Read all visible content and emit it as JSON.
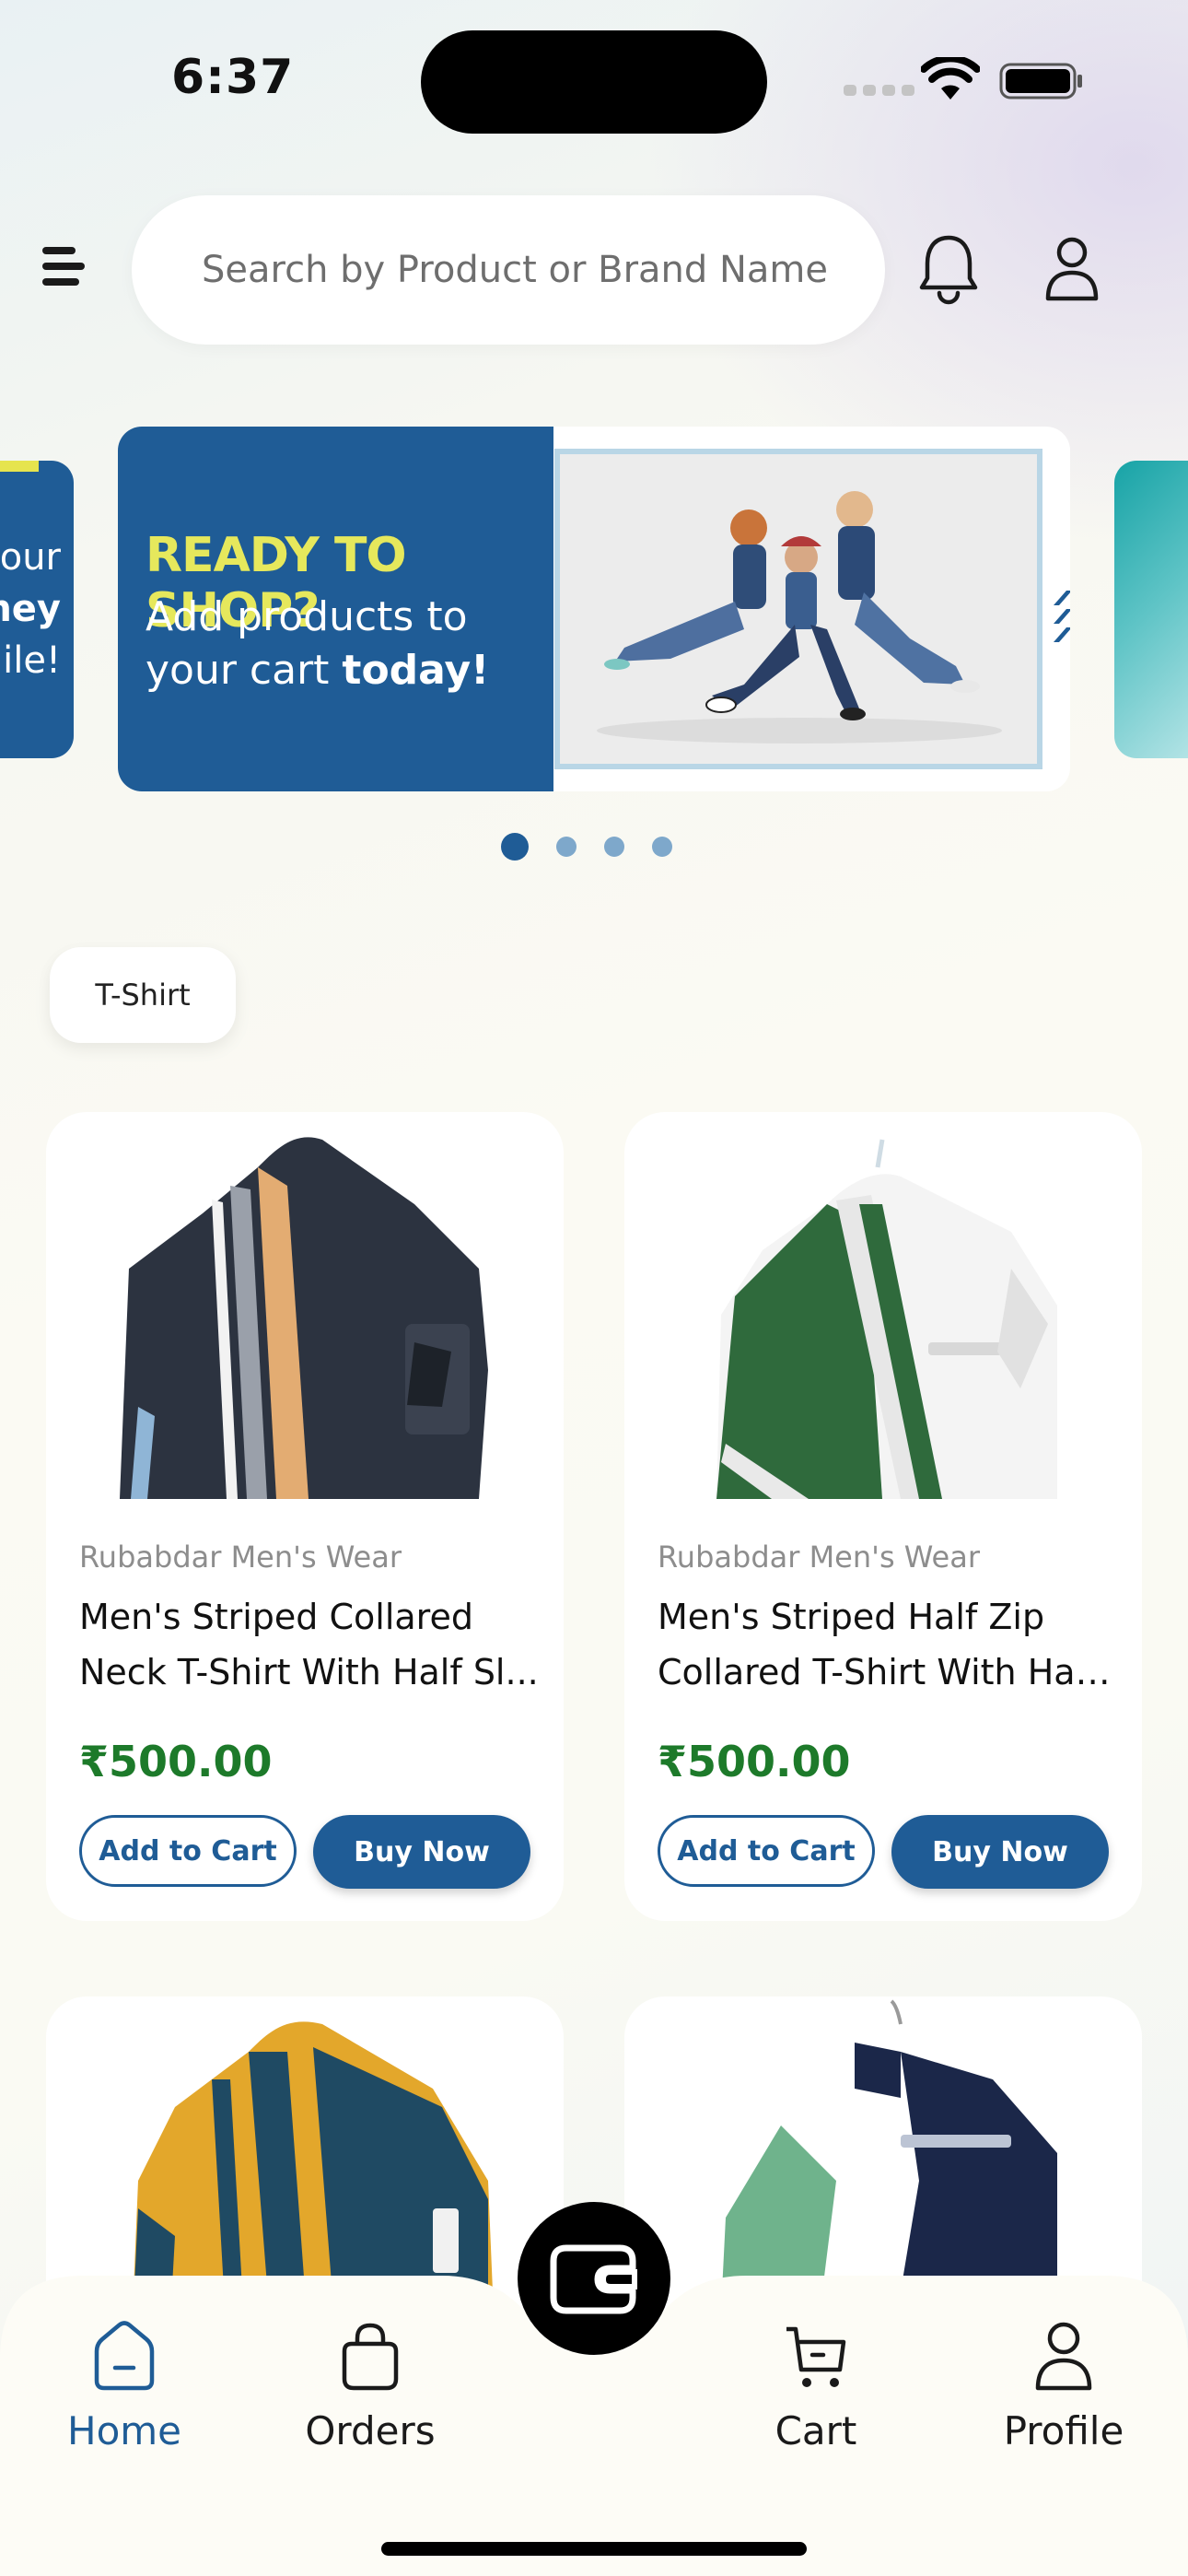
{
  "status_bar": {
    "time": "6:37"
  },
  "header": {
    "search_placeholder": "Search by Product or Brand Name"
  },
  "banners": {
    "left_peek": {
      "lines": [
        "our",
        "ney",
        "ile!"
      ]
    },
    "main": {
      "headline": "READY TO SHOP?",
      "line1": "Add products to",
      "line2_prefix": "your cart ",
      "line2_bold": "today!"
    },
    "dots": 4,
    "active_dot": 0
  },
  "category": {
    "label": "T-Shirt"
  },
  "products": [
    {
      "brand": "Rubabdar Men's Wear",
      "name_line1": "Men's Striped Collared",
      "name_line2": "Neck T-Shirt With Half Sl...",
      "price": "₹500.00",
      "add_label": "Add to Cart",
      "buy_label": "Buy Now",
      "main_color": "#2c3340",
      "stripe_color": "#e3ac72"
    },
    {
      "brand": "Rubabdar Men's Wear",
      "name_line1": "Men's Striped  Half Zip",
      "name_line2": "Collared T-Shirt With Half...",
      "price": "₹500.00",
      "add_label": "Add to Cart",
      "buy_label": "Buy Now",
      "main_color": "#2f6a3c",
      "stripe_color": "#ececec"
    },
    {
      "main_color": "#e3a72b",
      "stripe_color": "#1f4a63"
    },
    {
      "main_color": "#1b2749",
      "stripe_color": "#6fb38c"
    }
  ],
  "tabbar": {
    "home": "Home",
    "orders": "Orders",
    "cart": "Cart",
    "profile": "Profile",
    "active": "home"
  },
  "colors": {
    "primary": "#1f5c96",
    "price": "#1d7a2a",
    "banner_accent": "#e6e85c"
  }
}
